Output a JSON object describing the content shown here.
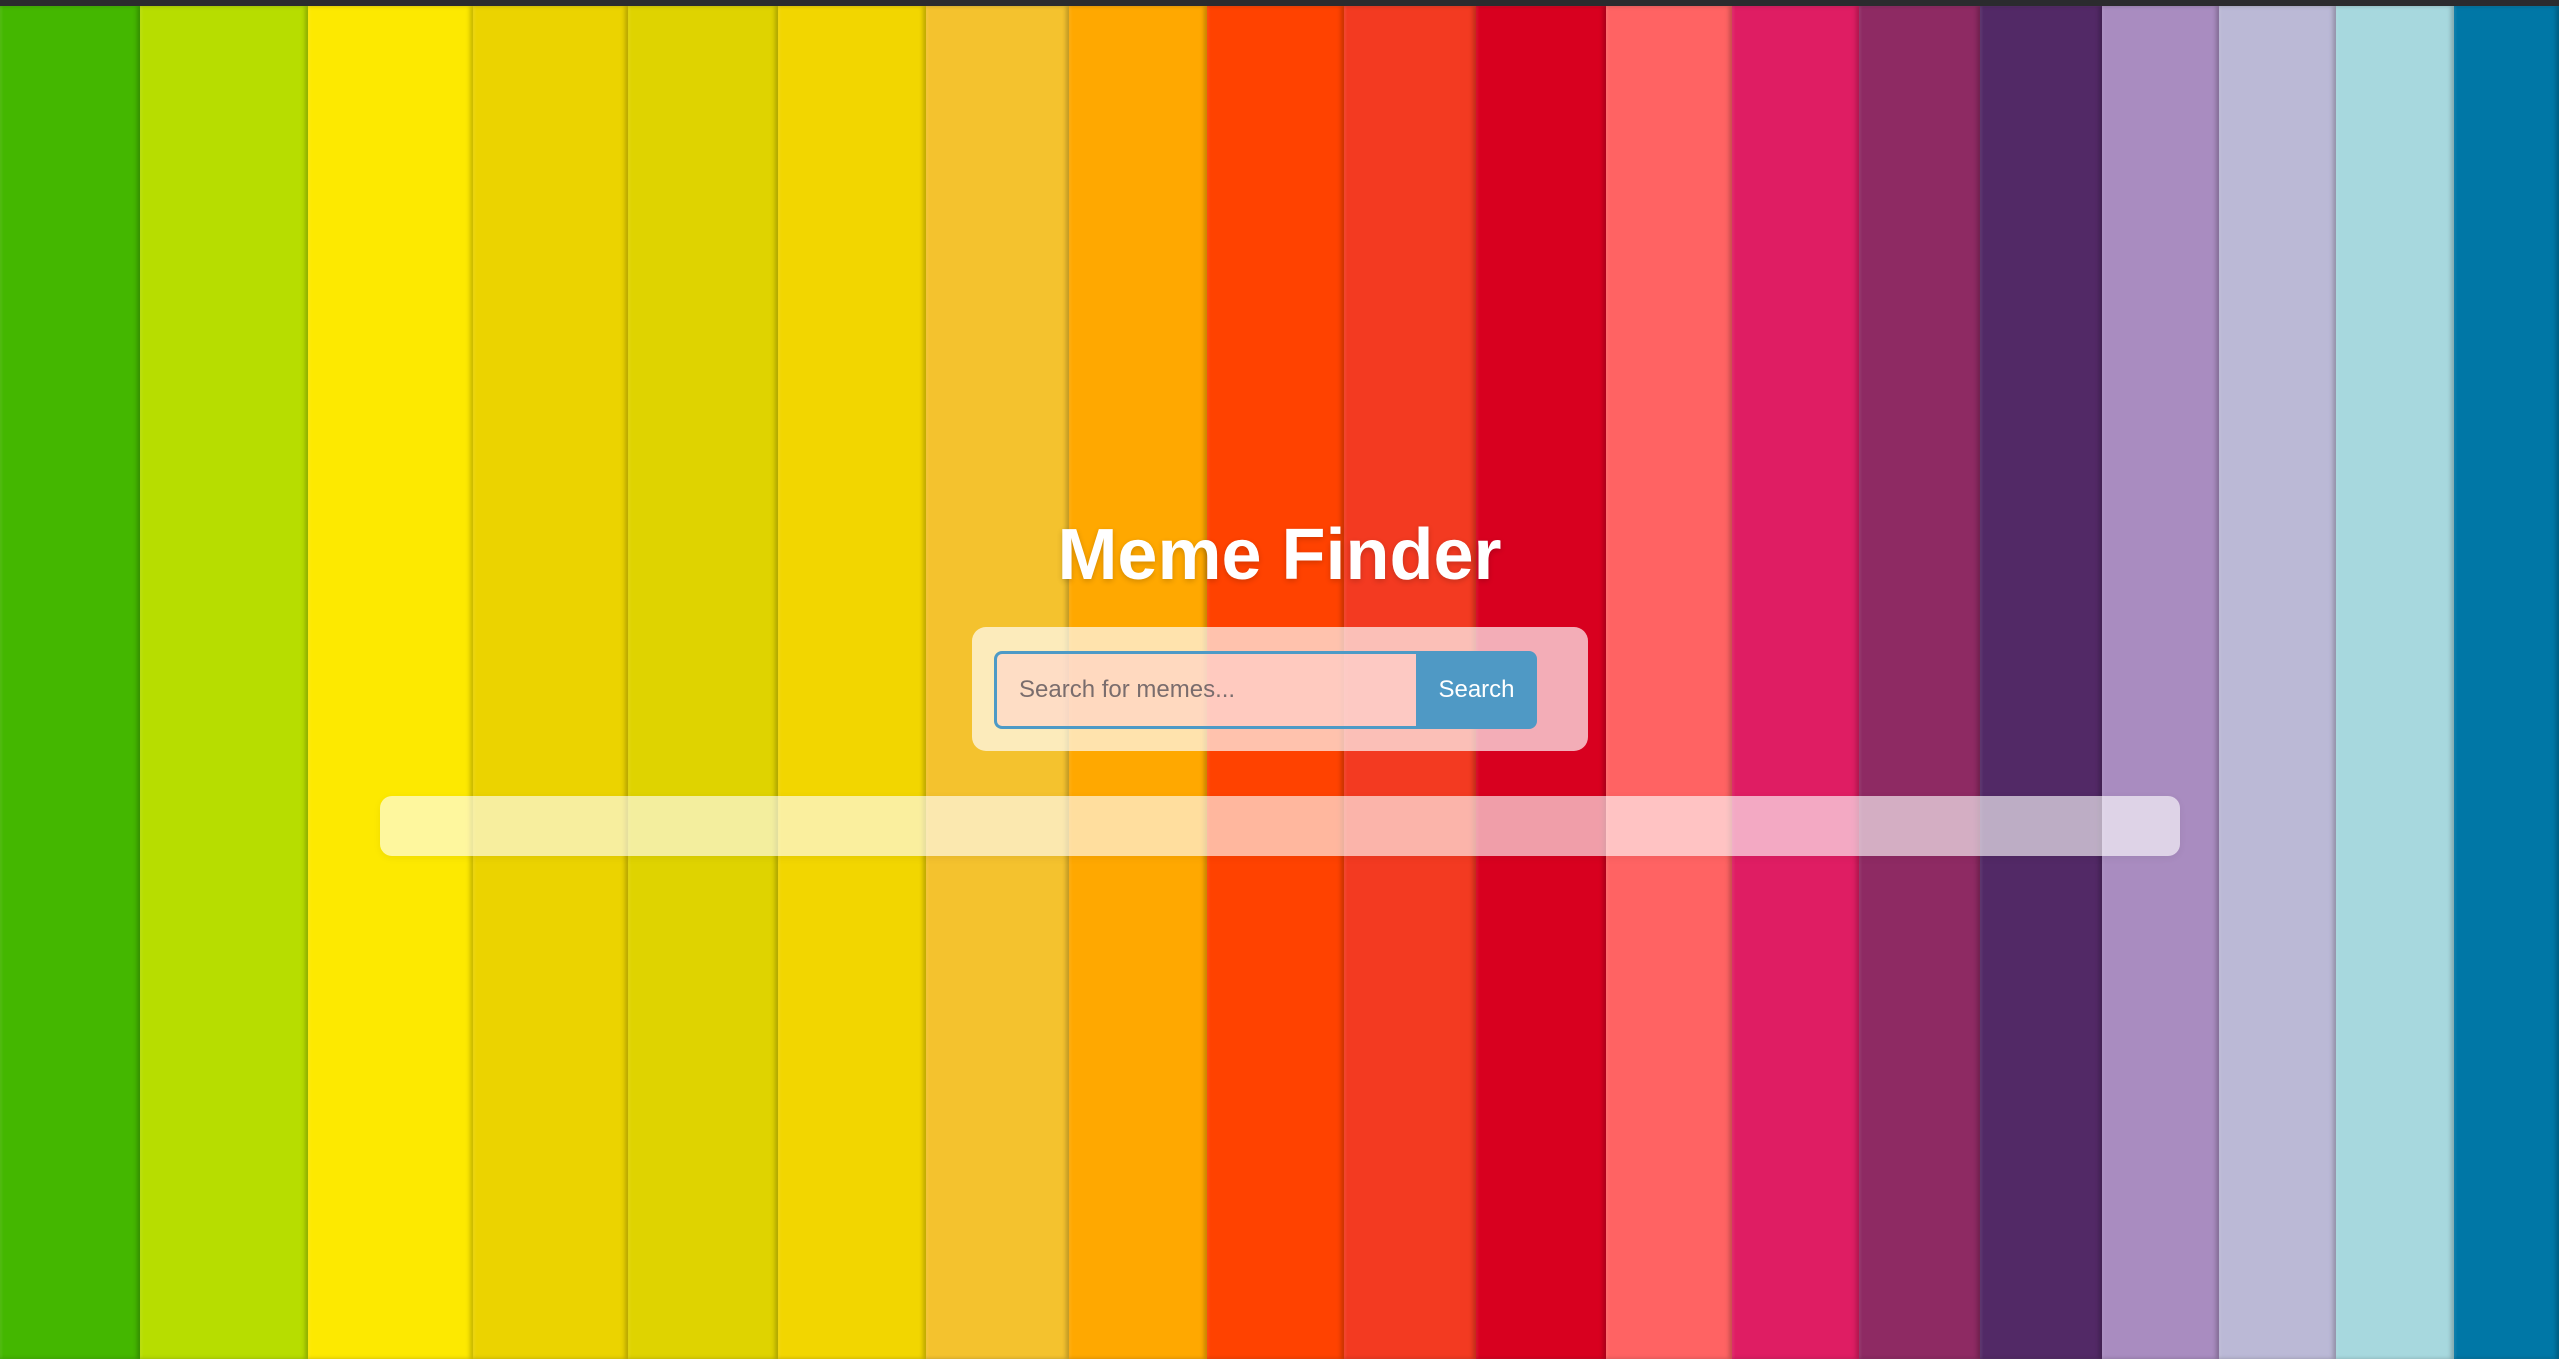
{
  "app": {
    "title": "Meme Finder"
  },
  "search": {
    "placeholder": "Search for memes...",
    "value": "",
    "button_label": "Search"
  },
  "results": {
    "items": []
  },
  "background": {
    "stripe_colors": [
      "#44b700",
      "#b7dd00",
      "#fde900",
      "#ebd300",
      "#dfd300",
      "#f2d600",
      "#f4c22e",
      "#ffa800",
      "#ff4200",
      "#f33a21",
      "#d8001f",
      "#ff6363",
      "#df1d63",
      "#8e2a63",
      "#522966",
      "#a98cc0",
      "#bbb9d6",
      "#a7d8de",
      "#0077a6"
    ],
    "accent_color": "#4f99c5"
  }
}
